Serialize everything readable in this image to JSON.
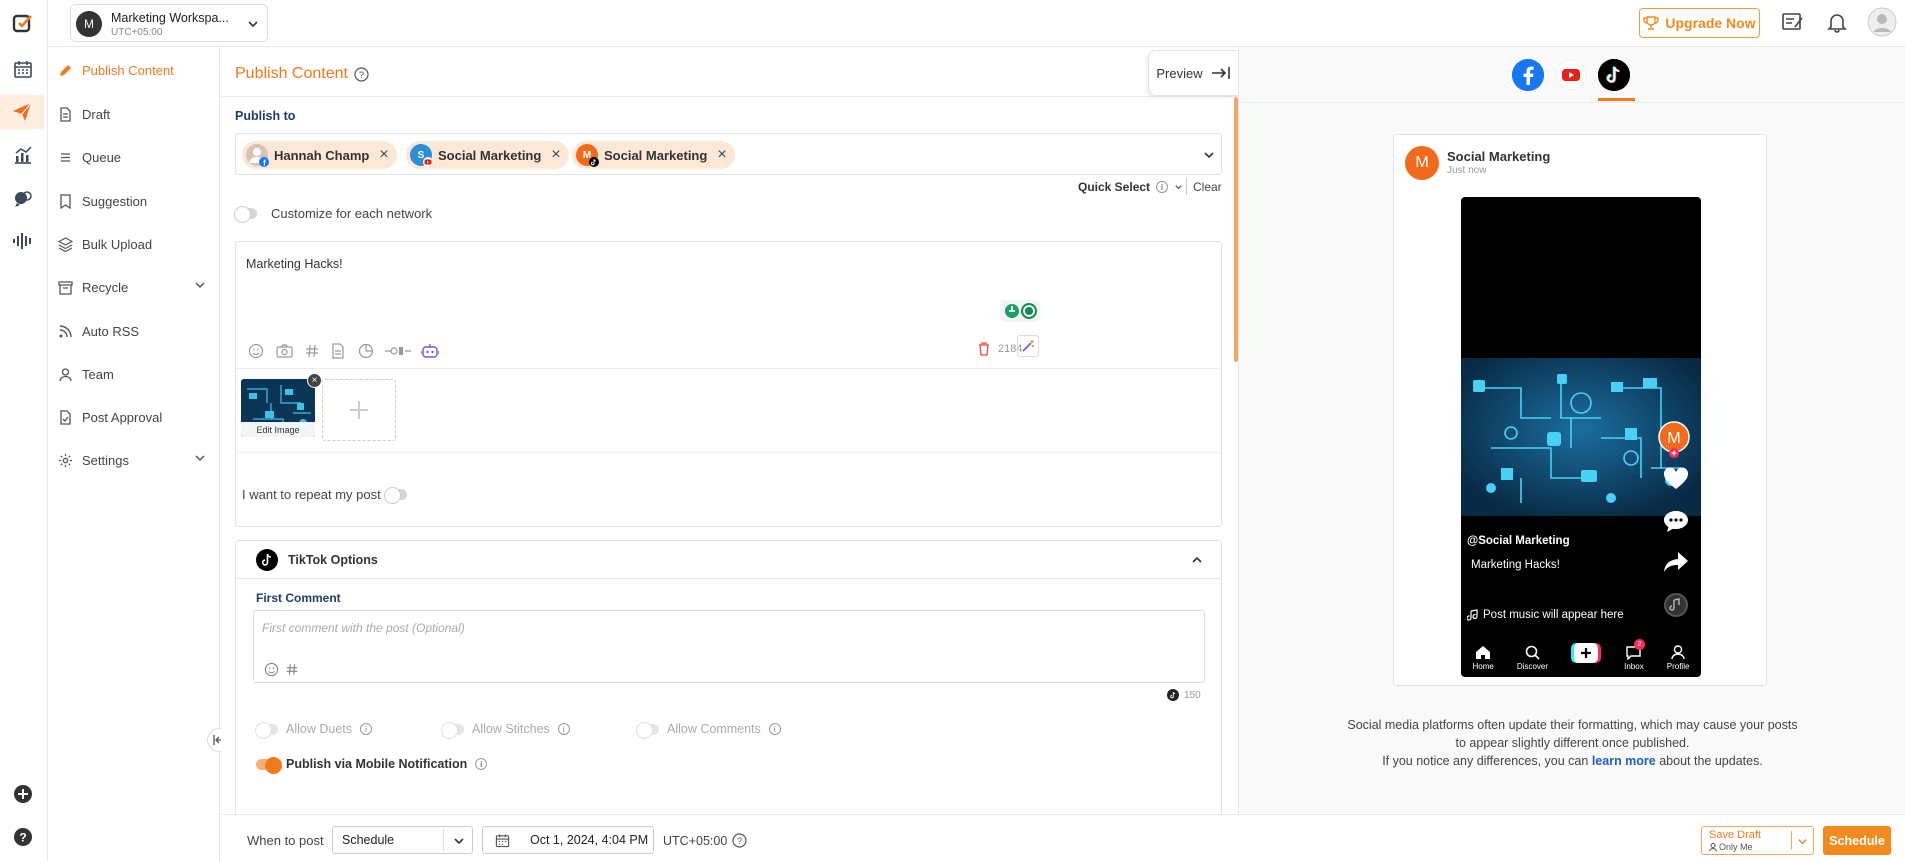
{
  "workspace": {
    "initial": "M",
    "name": "Marketing Workspa...",
    "timezone": "UTC+05:00"
  },
  "topbar": {
    "upgrade_label": "Upgrade Now"
  },
  "nav": {
    "items": [
      {
        "label": "Publish Content"
      },
      {
        "label": "Draft"
      },
      {
        "label": "Queue"
      },
      {
        "label": "Suggestion"
      },
      {
        "label": "Bulk Upload"
      },
      {
        "label": "Recycle"
      },
      {
        "label": "Auto RSS"
      },
      {
        "label": "Team"
      },
      {
        "label": "Post Approval"
      },
      {
        "label": "Settings"
      }
    ]
  },
  "main": {
    "title": "Publish Content",
    "preview_label": "Preview",
    "publish_to_label": "Publish to",
    "accounts": [
      {
        "name": "Hannah Champ",
        "network": "facebook"
      },
      {
        "name": "Social Marketing",
        "initial": "S",
        "network": "youtube"
      },
      {
        "name": "Social Marketing",
        "initial": "M",
        "network": "tiktok"
      }
    ],
    "quick_select": "Quick Select",
    "clear": "Clear",
    "customize_label": "Customize for each network",
    "post_text": "Marketing Hacks!",
    "char_count": "2184",
    "edit_image": "Edit Image",
    "repeat_label": "I want to repeat my post",
    "tiktok": {
      "title": "TikTok Options",
      "first_comment_label": "First Comment",
      "comment_placeholder": "First comment with the post (Optional)",
      "comment_count": "150",
      "allow_duets": "Allow Duets",
      "allow_stitches": "Allow Stitches",
      "allow_comments": "Allow Comments",
      "mobile_notification": "Publish via Mobile Notification"
    }
  },
  "bottom": {
    "when_label": "When to post",
    "schedule_option": "Schedule",
    "datetime": "Oct 1, 2024, 4:04 PM",
    "tz": "UTC+05:00",
    "save_draft": "Save Draft",
    "only_me": "Only Me",
    "schedule_btn": "Schedule"
  },
  "preview": {
    "account": "Social Marketing",
    "avatar_initial": "M",
    "time": "Just now",
    "handle": "@Social Marketing",
    "caption": "Marketing Hacks!",
    "music": "Post music will appear here",
    "tabs": [
      "Home",
      "Discover",
      "Inbox",
      "Profile"
    ],
    "inbox_badge": "2",
    "note_1": "Social media platforms often update their formatting, which may cause your posts",
    "note_2": "to appear slightly different once published.",
    "note_3_pre": "If you notice any differences, you can",
    "note_3_link": "learn more",
    "note_3_post": "about the updates."
  },
  "colors": {
    "accent": "#f2791e",
    "facebook": "#1877f2",
    "youtube": "#e62117",
    "tiktok": "#000000"
  }
}
